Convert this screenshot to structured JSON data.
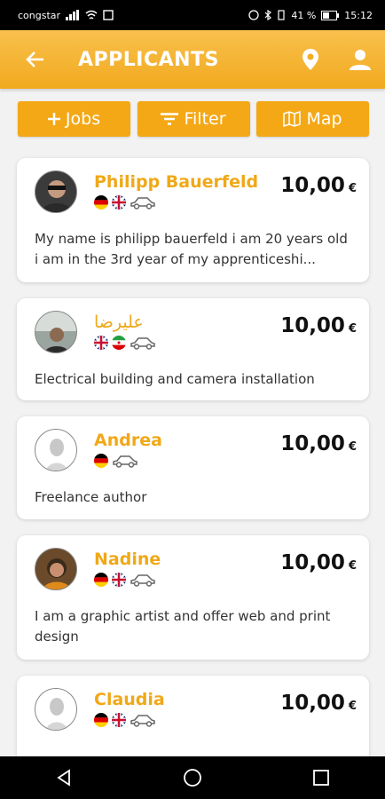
{
  "status": {
    "carrier": "congstar",
    "battery_text": "41 %",
    "time": "15:12"
  },
  "header": {
    "title": "APPLICANTS"
  },
  "toolbar": {
    "jobs": "Jobs",
    "filter": "Filter",
    "map": "Map"
  },
  "currency": "€",
  "applicants": [
    {
      "name": "Philipp Bauerfeld",
      "price": "10,00",
      "desc": "My name is philipp bauerfeld i am 20 years old i am in the 3rd year of my apprenticeshi..."
    },
    {
      "name": "عليرضا",
      "price": "10,00",
      "desc": "Electrical building and camera installation"
    },
    {
      "name": "Andrea",
      "price": "10,00",
      "desc": "Freelance author"
    },
    {
      "name": "Nadine",
      "price": "10,00",
      "desc": "I am a graphic artist and offer web and print design"
    },
    {
      "name": "Claudia",
      "price": "10,00",
      "desc": ""
    }
  ]
}
